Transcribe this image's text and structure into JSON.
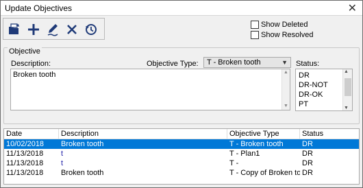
{
  "window": {
    "title": "Update Objectives",
    "close_glyph": "✕"
  },
  "toolbar": {
    "buttons": [
      {
        "name": "open-folder-icon",
        "tooltip": ""
      },
      {
        "name": "plus-icon"
      },
      {
        "name": "edit-pencil-icon"
      },
      {
        "name": "delete-x-icon"
      },
      {
        "name": "history-icon"
      }
    ]
  },
  "options": {
    "show_deleted": "Show Deleted",
    "show_resolved": "Show Resolved"
  },
  "objective": {
    "group_label": "Objective",
    "description_label": "Description:",
    "description_value": "Broken tooth",
    "type_label": "Objective Type:",
    "type_value": "T - Broken tooth",
    "status_label": "Status:",
    "status_options": [
      "DR",
      "DR-NOT",
      "DR-OK",
      "PT"
    ]
  },
  "grid": {
    "columns": [
      "Date",
      "Description",
      "Objective Type",
      "Status"
    ],
    "rows": [
      {
        "date": "10/02/2018",
        "description": "Broken tooth",
        "type": "T - Broken tooth",
        "status": "DR"
      },
      {
        "date": "11/13/2018",
        "description": "t",
        "type": "T - Plan1",
        "status": "DR"
      },
      {
        "date": "11/13/2018",
        "description": "t",
        "type": "T -",
        "status": "DR"
      },
      {
        "date": "11/13/2018",
        "description": "Broken tooth",
        "type": "T - Copy of Broken tooth",
        "status": "DR"
      }
    ]
  },
  "colors": {
    "selection": "#0078d7",
    "link": "#1a1aa6",
    "icon": "#1f3a78"
  }
}
